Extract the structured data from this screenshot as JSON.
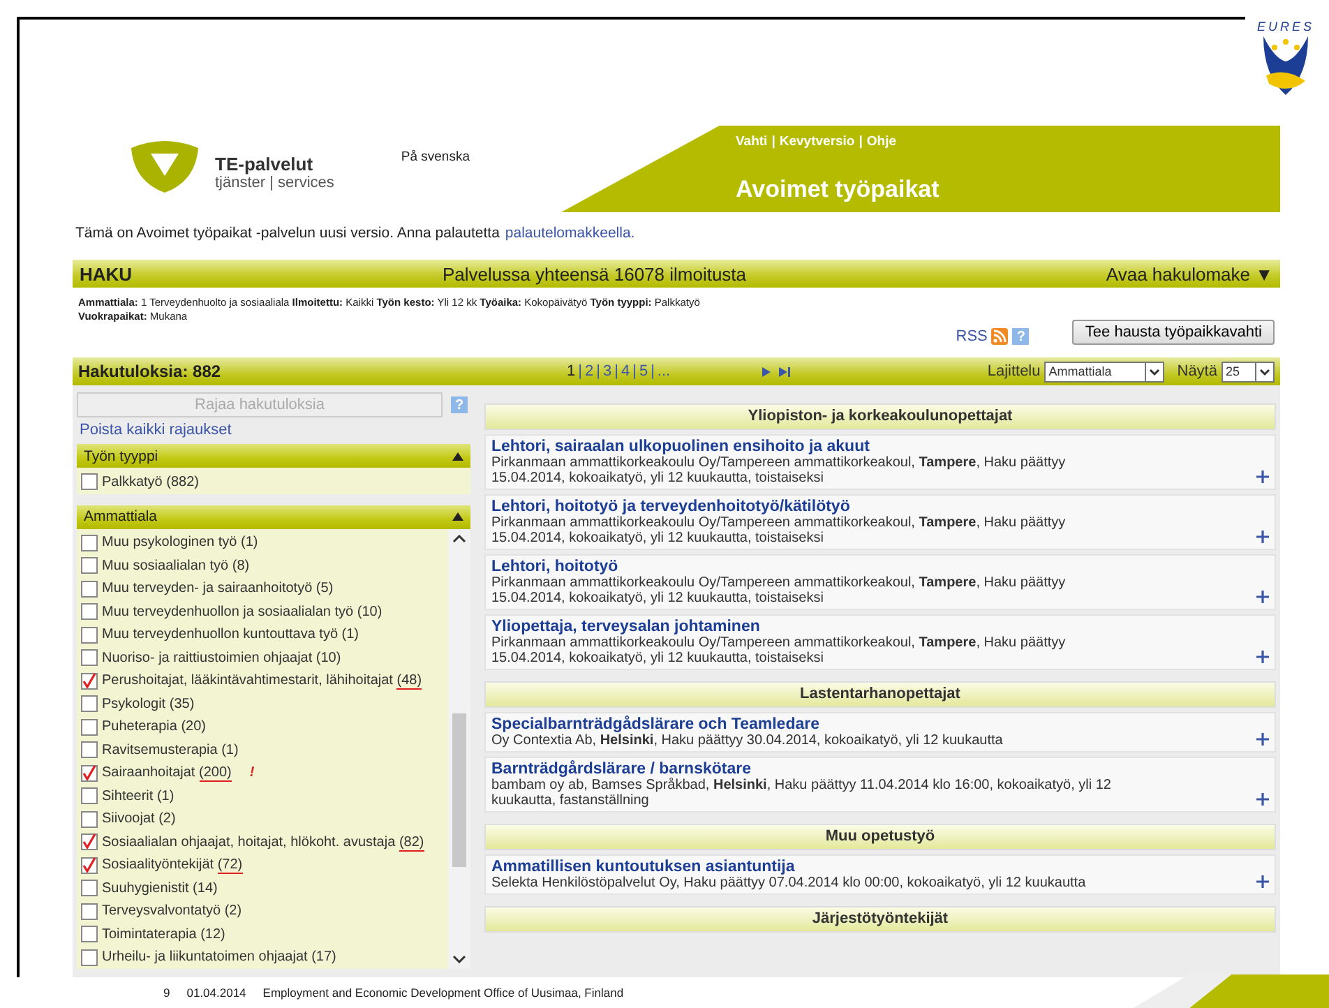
{
  "slide": {
    "logo_text": "EURES",
    "page_number": "9",
    "date": "01.04.2014",
    "footer": "Employment and Economic Development Office of Uusimaa, Finland"
  },
  "header": {
    "brand": "TE-palvelut",
    "brand_sub": "tjänster | services",
    "language_link": "På svenska",
    "links": [
      "Vahti",
      "Kevytversio",
      "Ohje"
    ],
    "separator": "|",
    "title": "Avoimet työpaikat"
  },
  "notice": {
    "text": "Tämä on Avoimet työpaikat -palvelun uusi versio. Anna palautetta",
    "link": "palautelomakkeella."
  },
  "search_bar": {
    "title": "HAKU",
    "summary": "Palvelussa yhteensä 16078 ilmoitusta",
    "toggle": "Avaa hakulomake ▼"
  },
  "criteria": {
    "lines": [
      "**Ammattiala:** 1 Terveydenhuolto ja sosiaaliala **Ilmoitettu:** Kaikki **Työn kesto:** Yli 12 kk **Työaika:** Kokopäivätyö **Työn tyyppi:** Palkkatyö",
      "**Vuokrapaikat:** Mukana"
    ],
    "rss": "RSS",
    "help": "?",
    "button": "Tee hausta työpaikkavahti"
  },
  "results_bar": {
    "count": "Hakutuloksia: 882",
    "separator": "|",
    "pages": [
      {
        "label": "1",
        "selected": true
      },
      {
        "label": "2",
        "selected": false
      },
      {
        "label": "3",
        "selected": false
      },
      {
        "label": "4",
        "selected": false
      },
      {
        "label": "5",
        "selected": false
      },
      {
        "label": "...",
        "selected": false
      }
    ],
    "sort_label": "Lajittelu",
    "sort_value": "Ammattiala",
    "show_label": "Näytä",
    "show_value": "25"
  },
  "filters": {
    "button": "Rajaa hakutuloksia",
    "help": "?",
    "clear_link": "Poista kaikki rajaukset",
    "facets": [
      {
        "title": "Työn tyyppi",
        "expanded": true,
        "items": [
          {
            "label": "Palkkatyö",
            "count": "(882)",
            "checked": false,
            "underlined": false
          }
        ]
      },
      {
        "title": "Ammattiala",
        "expanded": true,
        "items": [
          {
            "label": "Muu psykologinen työ",
            "count": "(1)",
            "checked": false,
            "underlined": false
          },
          {
            "label": "Muu sosiaalialan työ",
            "count": "(8)",
            "checked": false,
            "underlined": false
          },
          {
            "label": "Muu terveyden- ja sairaanhoitotyö",
            "count": "(5)",
            "checked": false,
            "underlined": false
          },
          {
            "label": "Muu terveydenhuollon ja sosiaalialan työ",
            "count": "(10)",
            "checked": false,
            "underlined": false
          },
          {
            "label": "Muu terveydenhuollon kuntouttava työ",
            "count": "(1)",
            "checked": false,
            "underlined": false
          },
          {
            "label": "Nuoriso- ja raittiustoimien ohjaajat",
            "count": "(10)",
            "checked": false,
            "underlined": false
          },
          {
            "label": "Perushoitajat, lääkintävahtimestarit, lähihoitajat",
            "count": "(48)",
            "checked": true,
            "underlined": true
          },
          {
            "label": "Psykologit",
            "count": "(35)",
            "checked": false,
            "underlined": false
          },
          {
            "label": "Puheterapia",
            "count": "(20)",
            "checked": false,
            "underlined": false
          },
          {
            "label": "Ravitsemusterapia",
            "count": "(1)",
            "checked": false,
            "underlined": false
          },
          {
            "label": "Sairaanhoitajat",
            "count": "(200)",
            "checked": true,
            "underlined": true,
            "note": "!"
          },
          {
            "label": "Sihteerit",
            "count": "(1)",
            "checked": false,
            "underlined": false
          },
          {
            "label": "Siivoojat",
            "count": "(2)",
            "checked": false,
            "underlined": false
          },
          {
            "label": "Sosiaalialan ohjaajat, hoitajat, hlökoht. avustaja",
            "count": "(82)",
            "checked": true,
            "underlined": true
          },
          {
            "label": "Sosiaalityöntekijät",
            "count": "(72)",
            "checked": true,
            "underlined": true
          },
          {
            "label": "Suuhygienistit",
            "count": "(14)",
            "checked": false,
            "underlined": false
          },
          {
            "label": "Terveysvalvontatyö",
            "count": "(2)",
            "checked": false,
            "underlined": false
          },
          {
            "label": "Toimintaterapia",
            "count": "(12)",
            "checked": false,
            "underlined": false
          },
          {
            "label": "Urheilu- ja liikuntatoimen ohjaajat",
            "count": "(17)",
            "checked": false,
            "underlined": false
          }
        ]
      }
    ]
  },
  "results": [
    {
      "heading": "Yliopiston- ja korkeakoulunopettajat",
      "jobs": [
        {
          "title": "Lehtori, sairaalan ulkopuolinen ensihoito ja akuut",
          "details": "Pirkanmaan ammattikorkeakoulu Oy/Tampereen ammattikorkeakoul, **Tampere**, Haku päättyy 15.04.2014, kokoaikatyö, yli 12 kuukautta, toistaiseksi"
        },
        {
          "title": "Lehtori, hoitotyö ja terveydenhoitotyö/kätilötyö",
          "details": "Pirkanmaan ammattikorkeakoulu Oy/Tampereen ammattikorkeakoul, **Tampere**, Haku päättyy 15.04.2014, kokoaikatyö, yli 12 kuukautta, toistaiseksi"
        },
        {
          "title": "Lehtori, hoitotyö",
          "details": "Pirkanmaan ammattikorkeakoulu Oy/Tampereen ammattikorkeakoul, **Tampere**, Haku päättyy 15.04.2014, kokoaikatyö, yli 12 kuukautta, toistaiseksi"
        },
        {
          "title": "Yliopettaja, terveysalan johtaminen",
          "details": "Pirkanmaan ammattikorkeakoulu Oy/Tampereen ammattikorkeakoul, **Tampere**, Haku päättyy 15.04.2014, kokoaikatyö, yli 12 kuukautta, toistaiseksi"
        }
      ]
    },
    {
      "heading": "Lastentarhanopettajat",
      "jobs": [
        {
          "title": "Specialbarnträdgådslärare och Teamledare",
          "details": "Oy Contextia Ab, **Helsinki**, Haku päättyy 30.04.2014, kokoaikatyö, yli 12 kuukautta"
        },
        {
          "title": "Barnträdgårdslärare / barnskötare",
          "details": "bambam oy ab, Bamses Språkbad, **Helsinki**, Haku päättyy 11.04.2014 klo 16:00, kokoaikatyö, yli 12 kuukautta, fastanställning"
        }
      ]
    },
    {
      "heading": "Muu opetustyö",
      "jobs": [
        {
          "title": "Ammatillisen kuntoutuksen asiantuntija",
          "details": "Selekta Henkilöstöpalvelut Oy, Haku päättyy 07.04.2014 klo 00:00, kokoaikatyö, yli 12 kuukautta"
        }
      ]
    },
    {
      "heading": "Järjestötyöntekijät"
    }
  ]
}
